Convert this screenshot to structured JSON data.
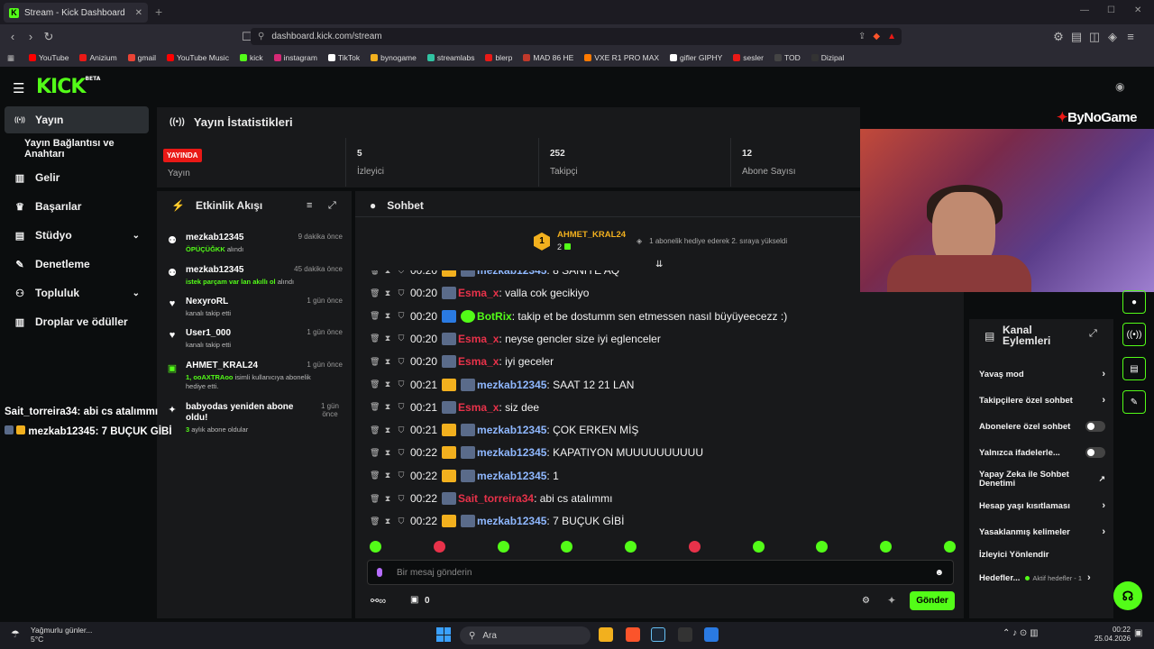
{
  "browser": {
    "tab_title": "Stream - Kick Dashboard",
    "url": "dashboard.kick.com/stream",
    "bookmarks": [
      {
        "label": "YouTube",
        "color": "#ff0000"
      },
      {
        "label": "Anizium",
        "color": "#e91916"
      },
      {
        "label": "gmail",
        "color": "#ea4335"
      },
      {
        "label": "YouTube Music",
        "color": "#ff0000"
      },
      {
        "label": "kick",
        "color": "#53fc18"
      },
      {
        "label": "instagram",
        "color": "#d62976"
      },
      {
        "label": "TikTok",
        "color": "#ffffff"
      },
      {
        "label": "bynogame",
        "color": "#f2b01e"
      },
      {
        "label": "streamlabs",
        "color": "#31c3a2"
      },
      {
        "label": "blerp",
        "color": "#e91916"
      },
      {
        "label": "MAD 86 HE",
        "color": "#c0392b"
      },
      {
        "label": "VXE R1 PRO MAX",
        "color": "#ff7a00"
      },
      {
        "label": "gifler GIPHY",
        "color": "#ffffff"
      },
      {
        "label": "sesler",
        "color": "#e91916"
      },
      {
        "label": "TOD",
        "color": "#444444"
      },
      {
        "label": "Dizipal",
        "color": "#333333"
      }
    ]
  },
  "sidebar": {
    "items": [
      {
        "label": "Yayın",
        "icon": "broadcast-icon"
      },
      {
        "label": "Yayın Bağlantısı ve Anahtarı",
        "icon": ""
      },
      {
        "label": "Gelir",
        "icon": "chart-icon"
      },
      {
        "label": "Başarılar",
        "icon": "trophy-icon"
      },
      {
        "label": "Stüdyo",
        "icon": "layout-icon"
      },
      {
        "label": "Denetleme",
        "icon": "wrench-icon"
      },
      {
        "label": "Topluluk",
        "icon": "people-icon"
      },
      {
        "label": "Droplar ve ödüller",
        "icon": "chart-icon"
      }
    ]
  },
  "stats": {
    "title": "Yayın İstatistikleri",
    "live_badge": "YAYINDA",
    "live_label": "Yayın",
    "cells": [
      {
        "value": "5",
        "label": "İzleyici"
      },
      {
        "value": "252",
        "label": "Takipçi"
      },
      {
        "value": "12",
        "label": "Abone Sayısı"
      }
    ]
  },
  "activity": {
    "title": "Etkinlik Akışı",
    "items": [
      {
        "name": "mezkab12345",
        "time": "9 dakika önce",
        "desc_highlight": "ÖPÜÇÜĞKK",
        "desc": " alındı",
        "icon": "redeem-icon"
      },
      {
        "name": "mezkab12345",
        "time": "45 dakika önce",
        "desc_highlight": "istek parçam var lan akıllı ol",
        "desc": " alındı",
        "icon": "redeem-icon"
      },
      {
        "name": "NexyroRL",
        "time": "1 gün önce",
        "desc_highlight": "",
        "desc": "kanalı takip etti",
        "icon": "heart-icon"
      },
      {
        "name": "User1_000",
        "time": "1 gün önce",
        "desc_highlight": "",
        "desc": "kanalı takip etti",
        "icon": "heart-icon"
      },
      {
        "name": "AHMET_KRAL24",
        "time": "1 gün önce",
        "desc_highlight": "1, ooAXTRAoo",
        "desc": " isimli kullanıcıya abonelik hediye etti.",
        "icon": "gift-icon"
      },
      {
        "name": "babyodas yeniden abone oldu!",
        "time": "1 gün önce",
        "desc_highlight": "3",
        "desc": " aylık abone oldular",
        "icon": "sparkle-icon"
      }
    ]
  },
  "chat": {
    "title": "Sohbet",
    "pinned": {
      "rank": "1",
      "name": "AHMET_KRAL24",
      "count": "2",
      "text": "1 abonelik hediye ederek 2. sıraya yükseldi"
    },
    "messages": [
      {
        "time": "00:20",
        "user": "mezkab12345",
        "color": "#8fb8ff",
        "crown": true,
        "text": ": 8 SANİYE AQ"
      },
      {
        "time": "00:20",
        "user": "Esma_x",
        "color": "#e8324a",
        "crown": false,
        "text": ": valla cok gecikiyo"
      },
      {
        "time": "00:20",
        "user": "BotRix",
        "color": "#53fc18",
        "crown": false,
        "text": ": takip et be dostumm sen etmessen nasıl büyüyeecezz :)"
      },
      {
        "time": "00:20",
        "user": "Esma_x",
        "color": "#e8324a",
        "crown": false,
        "text": ": neyse gencler size iyi eglenceler"
      },
      {
        "time": "00:20",
        "user": "Esma_x",
        "color": "#e8324a",
        "crown": false,
        "text": ": iyi geceler"
      },
      {
        "time": "00:21",
        "user": "mezkab12345",
        "color": "#8fb8ff",
        "crown": true,
        "text": ": SAAT 12 21 LAN"
      },
      {
        "time": "00:21",
        "user": "Esma_x",
        "color": "#e8324a",
        "crown": false,
        "text": ": siz dee"
      },
      {
        "time": "00:21",
        "user": "mezkab12345",
        "color": "#8fb8ff",
        "crown": true,
        "text": ": ÇOK ERKEN MİŞ"
      },
      {
        "time": "00:22",
        "user": "mezkab12345",
        "color": "#8fb8ff",
        "crown": true,
        "text": ": KAPATIYON MUUUUUUUUUU"
      },
      {
        "time": "00:22",
        "user": "mezkab12345",
        "color": "#8fb8ff",
        "crown": true,
        "text": ": 1"
      },
      {
        "time": "00:22",
        "user": "Sait_torreira34",
        "color": "#e8324a",
        "crown": false,
        "text": ": abi cs atalımmı"
      },
      {
        "time": "00:22",
        "user": "mezkab12345",
        "color": "#8fb8ff",
        "crown": true,
        "text": ": 7 BUÇUK GİBİ"
      }
    ],
    "input_placeholder": "Bir mesaj gönderin",
    "points": "0",
    "send_label": "Gönder"
  },
  "overlay": {
    "brand": "ByNoGame",
    "lines": [
      {
        "user": "Sait_torreira34",
        "color": "#e8324a",
        "text": ": abi cs atalımmı"
      },
      {
        "user": "mezkab12345",
        "color": "#8fb8ff",
        "text": ": 7 BUÇUK GİBİ"
      }
    ]
  },
  "channel_actions": {
    "title": "Kanal Eylemleri",
    "items": [
      {
        "label": "Yavaş mod",
        "control": "chevron"
      },
      {
        "label": "Takipçilere özel sohbet",
        "control": "chevron"
      },
      {
        "label": "Abonelere özel sohbet",
        "control": "toggle"
      },
      {
        "label": "Yalnızca ifadelerle...",
        "control": "toggle"
      },
      {
        "label": "Yapay Zeka ile Sohbet Denetimi",
        "control": "external"
      },
      {
        "label": "Hesap yaşı kısıtlaması",
        "control": "chevron"
      },
      {
        "label": "Yasaklanmış kelimeler",
        "control": "chevron"
      },
      {
        "label": "İzleyici Yönlendir",
        "control": "none"
      },
      {
        "label": "Hedefler...",
        "control": "chevron",
        "sub": "Aktif hedefler - 1"
      }
    ]
  },
  "taskbar": {
    "weather_title": "Yağmurlu günler...",
    "weather_temp": "5°C",
    "search_label": "Ara",
    "time": "00:22",
    "date": "25.04.2026"
  }
}
